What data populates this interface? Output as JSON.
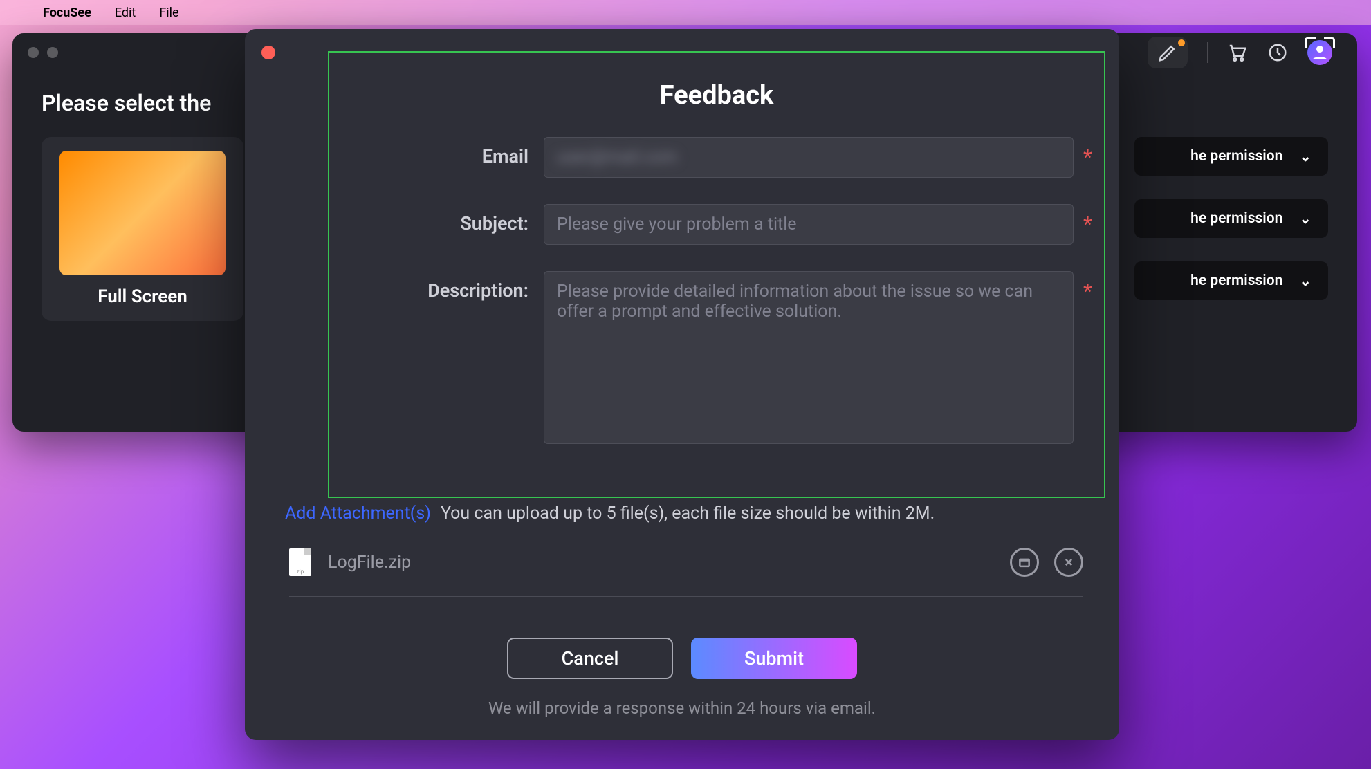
{
  "menu": {
    "app_name": "FocuSee",
    "items": [
      "Edit",
      "File"
    ]
  },
  "main_window": {
    "heading": "Please select the",
    "card_label": "Full Screen",
    "permission_btn_label": "he permission"
  },
  "modal": {
    "title": "Feedback",
    "email": {
      "label": "Email",
      "value": "user@mail.com"
    },
    "subject": {
      "label": "Subject:",
      "placeholder": "Please give your problem a title"
    },
    "description": {
      "label": "Description:",
      "placeholder": "Please provide detailed information about the issue so we can offer a prompt and effective solution."
    },
    "attachment": {
      "link": "Add Attachment(s)",
      "note": "You can upload up to 5 file(s), each file size should be within 2M.",
      "file_name": "LogFile.zip",
      "file_ext": "zip"
    },
    "buttons": {
      "cancel": "Cancel",
      "submit": "Submit"
    },
    "response_note": "We will provide a response within 24 hours via email."
  }
}
